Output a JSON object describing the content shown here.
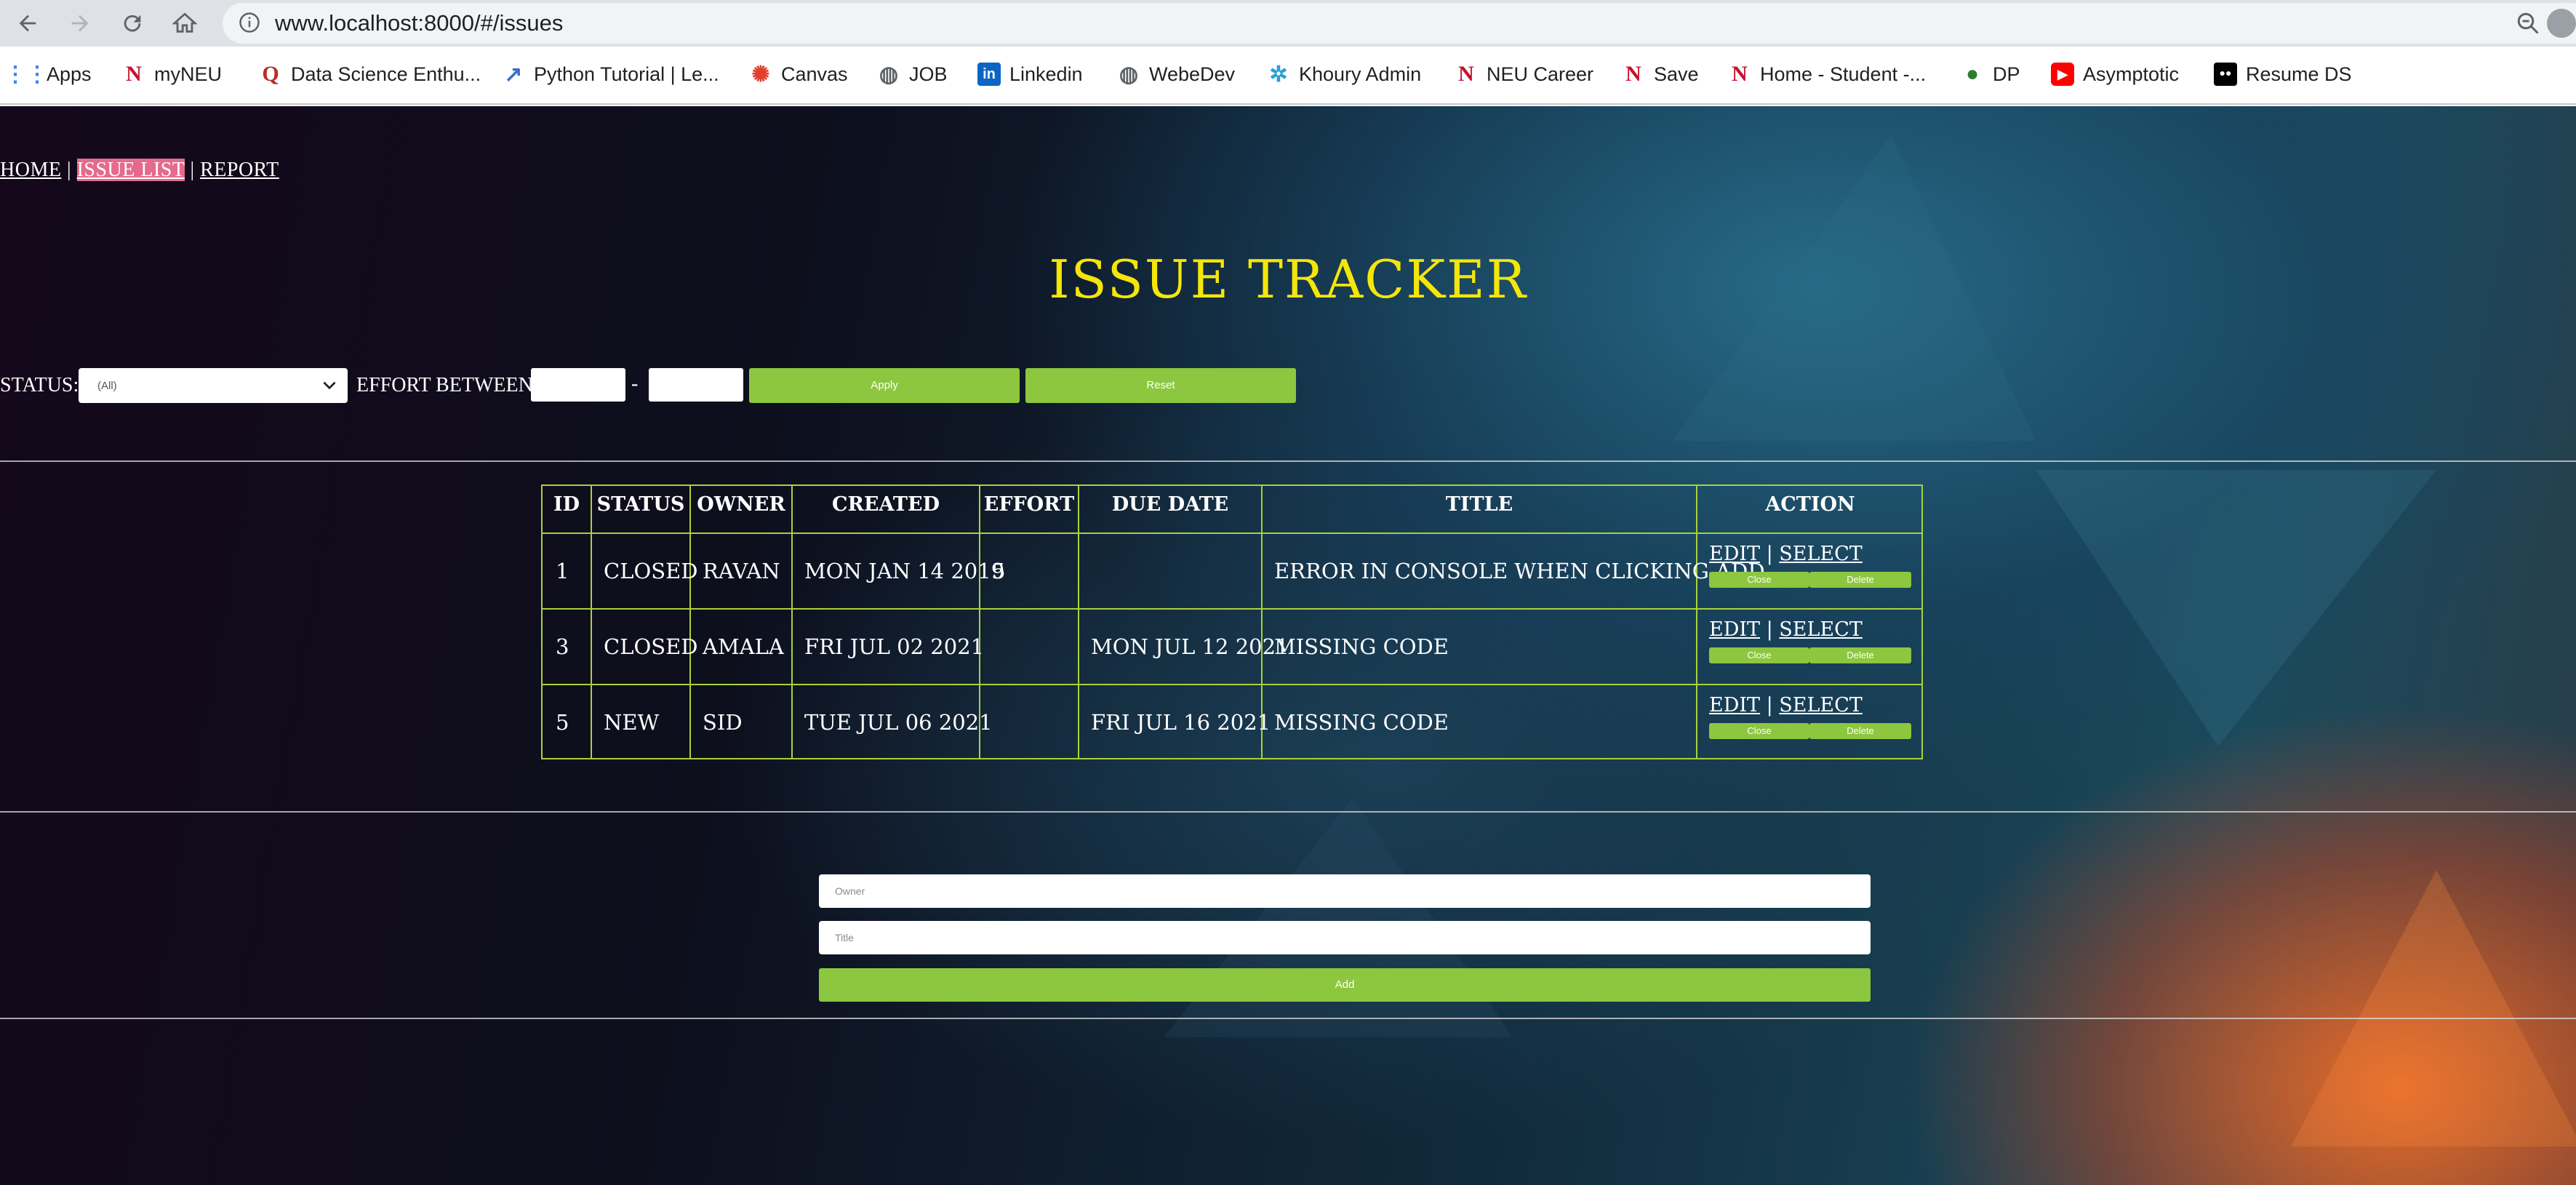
{
  "browser": {
    "url": "www.localhost:8000/#/issues",
    "bookmarks": [
      {
        "label": "Apps",
        "icon": "apps-grid-icon",
        "color": "#4285f4"
      },
      {
        "label": "myNEU",
        "icon": "neu-logo-icon",
        "color": "#c8102e"
      },
      {
        "label": "Data Science Enthu...",
        "icon": "quora-icon",
        "color": "#b92b27"
      },
      {
        "label": "Python Tutorial | Le...",
        "icon": "chart-icon",
        "color": "#3a6fc4"
      },
      {
        "label": "Canvas",
        "icon": "canvas-icon",
        "color": "#e13f2b"
      },
      {
        "label": "JOB",
        "icon": "globe-icon",
        "color": "#5f6368"
      },
      {
        "label": "Linkedin",
        "icon": "linkedin-icon",
        "color": "#0a66c2"
      },
      {
        "label": "WebeDev",
        "icon": "globe-icon",
        "color": "#5f6368"
      },
      {
        "label": "Khoury Admin",
        "icon": "khoury-icon",
        "color": "#2a9fd6"
      },
      {
        "label": "NEU Career",
        "icon": "neu-logo-icon",
        "color": "#c8102e"
      },
      {
        "label": "Save",
        "icon": "neu-logo-icon",
        "color": "#c8102e"
      },
      {
        "label": "Home - Student -...",
        "icon": "neu-logo-icon",
        "color": "#c8102e"
      },
      {
        "label": "DP",
        "icon": "dp-icon",
        "color": "#2e7d32"
      },
      {
        "label": "Asymptotic",
        "icon": "youtube-icon",
        "color": "#ff0000"
      },
      {
        "label": "Resume DS",
        "icon": "medium-icon",
        "color": "#000000"
      }
    ]
  },
  "nav": {
    "home": "HOME",
    "sep1": " | ",
    "issue_list": "ISSUE LIST",
    "sep2": " | ",
    "report": "REPORT"
  },
  "title": "ISSUE TRACKER",
  "filter": {
    "status_label": "STATUS:",
    "status_value": "(All)",
    "effort_label": "EFFORT BETWEEN:",
    "dash": "-",
    "apply": "Apply",
    "reset": "Reset"
  },
  "table": {
    "headers": [
      "ID",
      "STATUS",
      "OWNER",
      "CREATED",
      "EFFORT",
      "DUE DATE",
      "TITLE",
      "ACTION"
    ],
    "rows": [
      {
        "id": "1",
        "status": "CLOSED",
        "owner": "RAVAN",
        "created": "MON JAN 14 2019",
        "effort": "5",
        "due": "",
        "title": "ERROR IN CONSOLE WHEN CLICKING ADD"
      },
      {
        "id": "3",
        "status": "CLOSED",
        "owner": "AMALA",
        "created": "FRI JUL 02 2021",
        "effort": "",
        "due": "MON JUL 12 2021",
        "title": "MISSING CODE"
      },
      {
        "id": "5",
        "status": "NEW",
        "owner": "SID",
        "created": "TUE JUL 06 2021",
        "effort": "",
        "due": "FRI JUL 16 2021",
        "title": "MISSING CODE"
      }
    ],
    "action": {
      "edit": "EDIT",
      "sep": " | ",
      "select": "SELECT",
      "close": "Close",
      "delete": "Delete"
    }
  },
  "add_form": {
    "owner_placeholder": "Owner",
    "title_placeholder": "Title",
    "add": "Add"
  },
  "colors": {
    "accent_green": "#8dc63f",
    "title_yellow": "#f5e60a",
    "active_nav": "#e56a8b",
    "table_border": "#a9d13a"
  }
}
